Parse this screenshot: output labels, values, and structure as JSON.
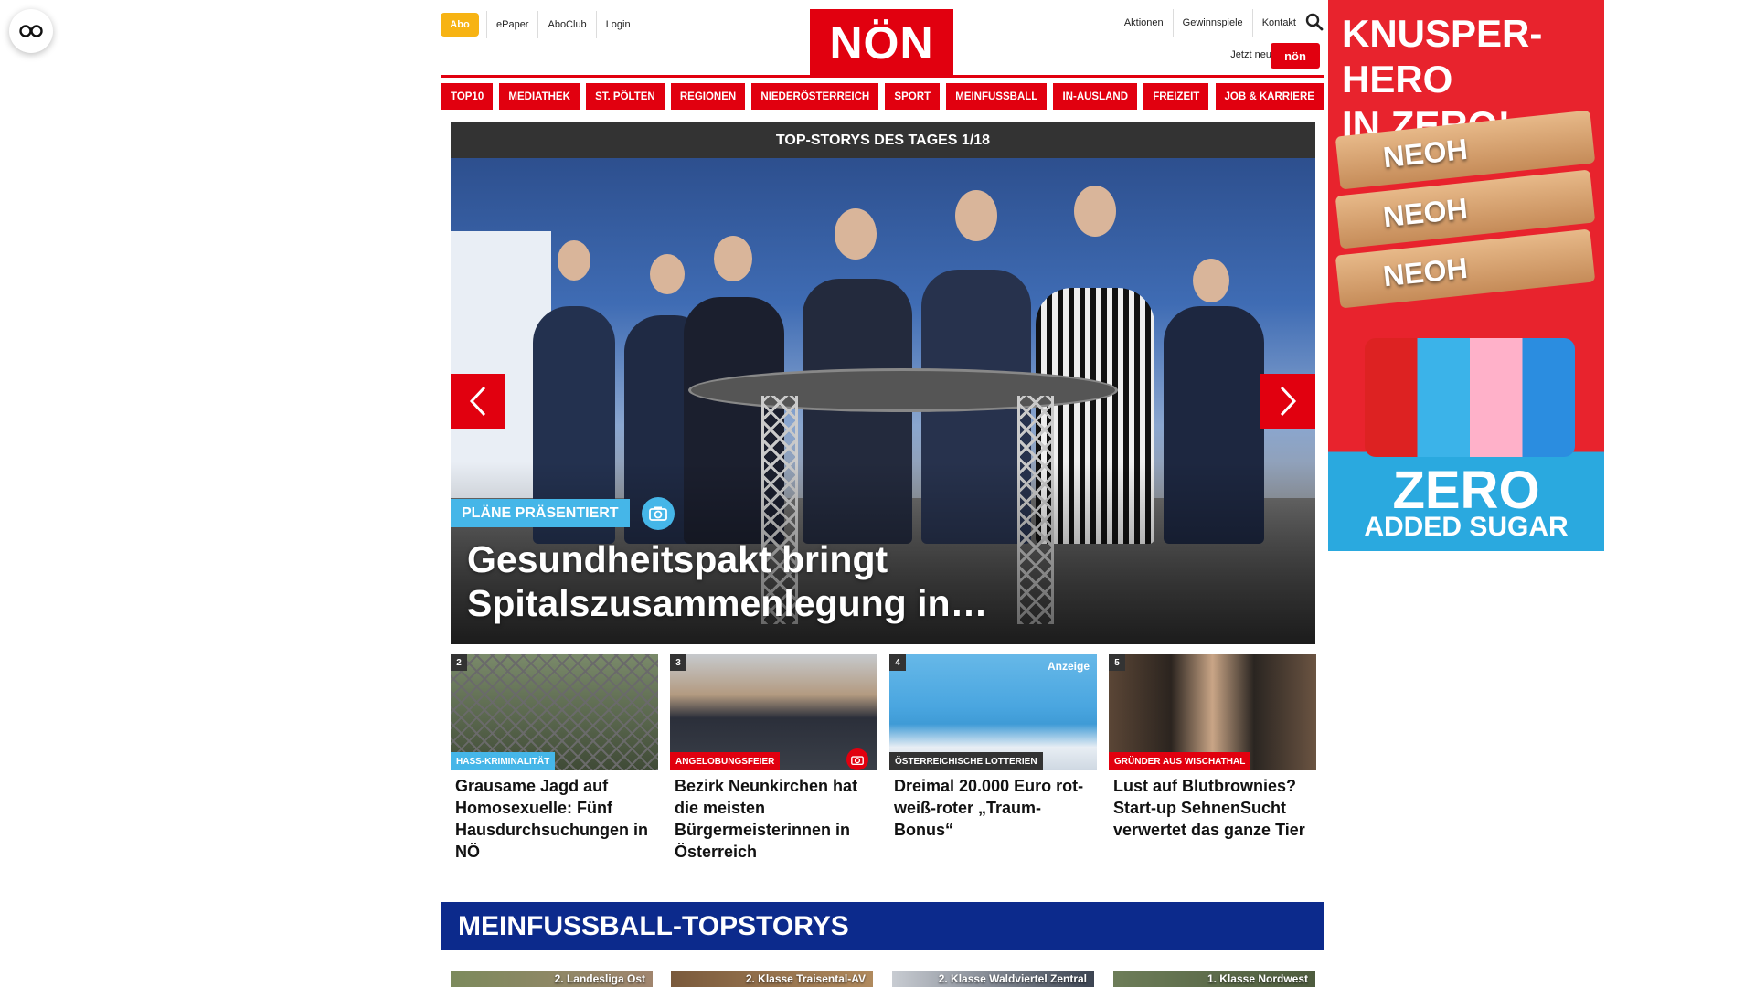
{
  "header": {
    "abo_label": "Abo",
    "left_links": [
      "ePaper",
      "AboClub",
      "Login"
    ],
    "logo_text": "NÖN",
    "right_links": [
      "Aktionen",
      "Gewinnspiele",
      "Kontakt"
    ],
    "jetzt_neu": "Jetzt neu:",
    "kinder_badge": "nön"
  },
  "nav": {
    "items": [
      "TOP10",
      "MEDIATHEK",
      "ST. PÖLTEN",
      "REGIONEN",
      "NIEDERÖSTERREICH",
      "SPORT",
      "MEINFUSSBALL",
      "IN-AUSLAND",
      "FREIZEIT",
      "JOB & KARRIERE"
    ]
  },
  "hero": {
    "bar_title": "TOP-STORYS DES TAGES 1/18",
    "tag": "PLÄNE PRÄSENTIERT",
    "title": "Gesundheitspakt bringt Spitalszusammenlegung in…"
  },
  "cards": [
    {
      "num": "2",
      "category": "HASS-KRIMINALITÄT",
      "title": "Grausame Jagd auf Homosexuelle: Fünf Hausdurchsuchungen in NÖ",
      "cat_color": "#45b6e8"
    },
    {
      "num": "3",
      "category": "ANGELOBUNGSFEIER",
      "title": "Bezirk Neunkirchen hat die meisten Bürgermeisterinnen in Österreich",
      "cat_color": "#e1000f"
    },
    {
      "num": "4",
      "category": "ÖSTERREICHISCHE LOTTERIEN",
      "title": "Dreimal 20.000 Euro rot-weiß-roter „Traum-Bonus“",
      "cat_color": "#333333",
      "badge": "Anzeige"
    },
    {
      "num": "5",
      "category": "GRÜNDER AUS WISCHATHAL",
      "title": "Lust auf Blutbrownies? Start-up SehnenSucht verwertet das ganze Tier",
      "cat_color": "#e1000f"
    }
  ],
  "section": {
    "title": "MEINFUSSBALL-TOPSTORYS",
    "cards": [
      "2. Landesliga Ost",
      "2. Klasse Traisental-AV",
      "2. Klasse Waldviertel Zentral",
      "1. Klasse Nordwest"
    ]
  },
  "ad": {
    "headline_1": "KNUSPER-HERO",
    "headline_2": "IN ZERO!",
    "brand": "NEOH",
    "zero": "ZERO",
    "added_sugar": "ADDED SUGAR"
  },
  "colors": {
    "brand_red": "#e1000f",
    "abo_yellow": "#f7b313",
    "tag_blue": "#45b6e8",
    "section_blue": "#0c2a8c"
  }
}
